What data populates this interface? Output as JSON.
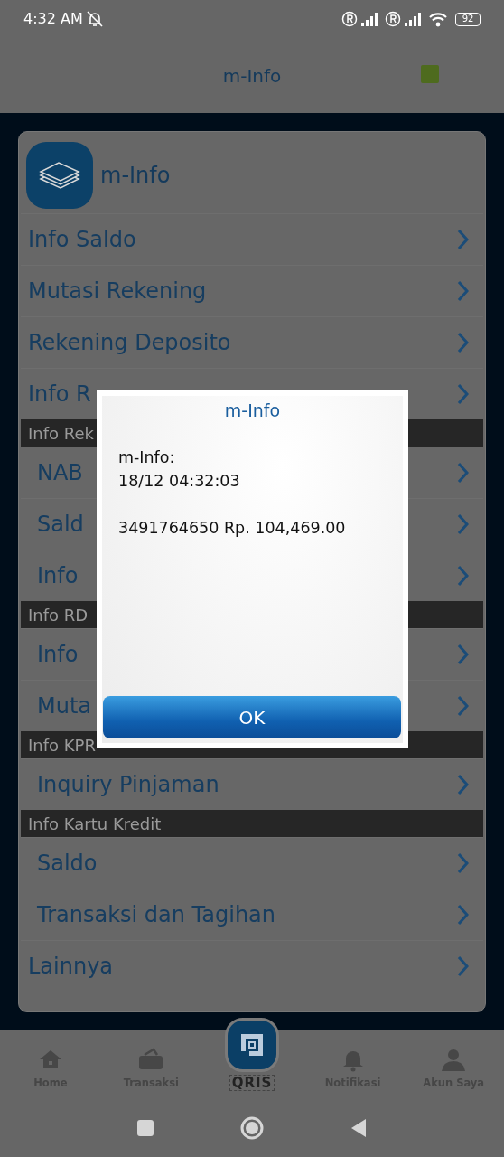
{
  "status_bar": {
    "time": "4:32 AM",
    "battery": "92"
  },
  "app_bar": {
    "title": "m-Info"
  },
  "card": {
    "title": "m-Info",
    "items": [
      {
        "kind": "item",
        "label": "Info Saldo"
      },
      {
        "kind": "item",
        "label": "Mutasi Rekening"
      },
      {
        "kind": "item",
        "label": "Rekening Deposito"
      },
      {
        "kind": "item",
        "label": "Info R"
      },
      {
        "kind": "section",
        "label": "Info Rek",
        "children": [
          {
            "kind": "item",
            "label": "NAB"
          },
          {
            "kind": "item",
            "label": "Sald"
          },
          {
            "kind": "item",
            "label": "Info"
          }
        ]
      },
      {
        "kind": "section",
        "label": "Info RD",
        "children": [
          {
            "kind": "item",
            "label": "Info"
          },
          {
            "kind": "item",
            "label": "Muta"
          }
        ]
      },
      {
        "kind": "section",
        "label": "Info KPR",
        "children": [
          {
            "kind": "item",
            "label": "Inquiry Pinjaman"
          }
        ]
      },
      {
        "kind": "section",
        "label": "Info Kartu Kredit",
        "children": [
          {
            "kind": "item",
            "label": "Saldo"
          },
          {
            "kind": "item",
            "label": "Transaksi dan Tagihan"
          }
        ]
      },
      {
        "kind": "item",
        "label": "Lainnya"
      }
    ]
  },
  "dialog": {
    "title": "m-Info",
    "paragraphs": [
      [
        "m-Info:",
        "18/12 04:32:03"
      ],
      [
        "3491764650 Rp. 104,469.00"
      ]
    ],
    "button": "OK"
  },
  "bottom_nav": [
    {
      "kind": "home",
      "label": "Home"
    },
    {
      "kind": "wallet",
      "label": "Transaksi"
    },
    {
      "kind": "qris",
      "label": "QRIS"
    },
    {
      "kind": "bell",
      "label": "Notifikasi"
    },
    {
      "kind": "person",
      "label": "Akun Saya"
    }
  ]
}
